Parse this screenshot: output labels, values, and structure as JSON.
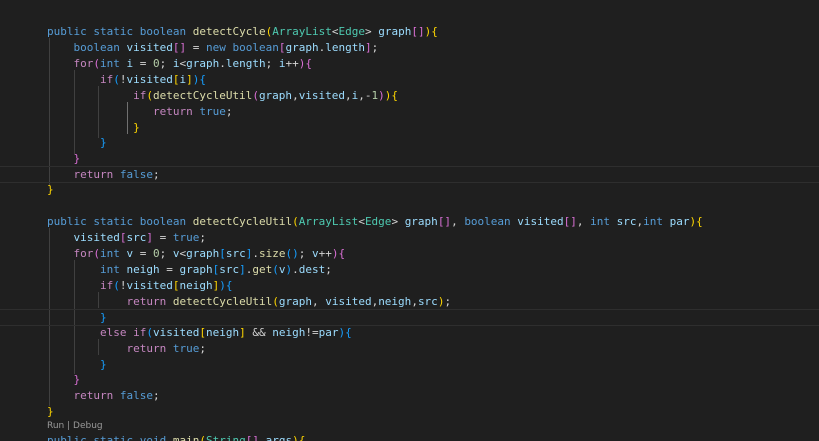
{
  "editor": {
    "language": "java",
    "theme_background": "#1f1f1f",
    "codelens": {
      "run": "Run",
      "separator": " | ",
      "debug": "Debug"
    },
    "lines": [
      [
        [
          "kw",
          "public"
        ],
        [
          "op",
          " "
        ],
        [
          "kw",
          "static"
        ],
        [
          "op",
          " "
        ],
        [
          "kw",
          "boolean"
        ],
        [
          "op",
          " "
        ],
        [
          "fn",
          "detectCycle"
        ],
        [
          "b1",
          "("
        ],
        [
          "ty",
          "ArrayList"
        ],
        [
          "op",
          "<"
        ],
        [
          "ty",
          "Edge"
        ],
        [
          "op",
          "> "
        ],
        [
          "var",
          "graph"
        ],
        [
          "b2",
          "[]"
        ],
        [
          "b1",
          ")"
        ],
        [
          "b1",
          "{"
        ]
      ],
      [
        [
          "op",
          "    "
        ],
        [
          "kw",
          "boolean"
        ],
        [
          "op",
          " "
        ],
        [
          "var",
          "visited"
        ],
        [
          "b2",
          "[]"
        ],
        [
          "op",
          " = "
        ],
        [
          "kw",
          "new"
        ],
        [
          "op",
          " "
        ],
        [
          "kw",
          "boolean"
        ],
        [
          "b2",
          "["
        ],
        [
          "var",
          "graph"
        ],
        [
          "op",
          "."
        ],
        [
          "var",
          "length"
        ],
        [
          "b2",
          "]"
        ],
        [
          "op",
          ";"
        ]
      ],
      [
        [
          "op",
          "    "
        ],
        [
          "ctl",
          "for"
        ],
        [
          "b2",
          "("
        ],
        [
          "kw",
          "int"
        ],
        [
          "op",
          " "
        ],
        [
          "var",
          "i"
        ],
        [
          "op",
          " = "
        ],
        [
          "num",
          "0"
        ],
        [
          "op",
          "; "
        ],
        [
          "var",
          "i"
        ],
        [
          "op",
          "<"
        ],
        [
          "var",
          "graph"
        ],
        [
          "op",
          "."
        ],
        [
          "var",
          "length"
        ],
        [
          "op",
          "; "
        ],
        [
          "var",
          "i"
        ],
        [
          "op",
          "++"
        ],
        [
          "b2",
          ")"
        ],
        [
          "b2",
          "{"
        ]
      ],
      [
        [
          "op",
          "        "
        ],
        [
          "ctl",
          "if"
        ],
        [
          "b3",
          "("
        ],
        [
          "op",
          "!"
        ],
        [
          "var",
          "visited"
        ],
        [
          "b1",
          "["
        ],
        [
          "var",
          "i"
        ],
        [
          "b1",
          "]"
        ],
        [
          "b3",
          ")"
        ],
        [
          "b3",
          "{"
        ]
      ],
      [
        [
          "op",
          "             "
        ],
        [
          "ctl",
          "if"
        ],
        [
          "b1",
          "("
        ],
        [
          "fn",
          "detectCycleUtil"
        ],
        [
          "b2",
          "("
        ],
        [
          "var",
          "graph"
        ],
        [
          "op",
          ","
        ],
        [
          "var",
          "visited"
        ],
        [
          "op",
          ","
        ],
        [
          "var",
          "i"
        ],
        [
          "op",
          ","
        ],
        [
          "op",
          "-"
        ],
        [
          "num",
          "1"
        ],
        [
          "b2",
          ")"
        ],
        [
          "b1",
          ")"
        ],
        [
          "b1",
          "{"
        ]
      ],
      [
        [
          "op",
          "                "
        ],
        [
          "ctl",
          "return"
        ],
        [
          "op",
          " "
        ],
        [
          "kw",
          "true"
        ],
        [
          "op",
          ";"
        ]
      ],
      [
        [
          "op",
          "             "
        ],
        [
          "b1",
          "}"
        ]
      ],
      [
        [
          "op",
          "        "
        ],
        [
          "b3",
          "}"
        ]
      ],
      [
        [
          "op",
          "    "
        ],
        [
          "b2",
          "}"
        ]
      ],
      [
        [
          "op",
          "    "
        ],
        [
          "ctl",
          "return"
        ],
        [
          "op",
          " "
        ],
        [
          "kw",
          "false"
        ],
        [
          "op",
          ";"
        ]
      ],
      [
        [
          "b1",
          "}"
        ]
      ],
      [],
      [
        [
          "kw",
          "public"
        ],
        [
          "op",
          " "
        ],
        [
          "kw",
          "static"
        ],
        [
          "op",
          " "
        ],
        [
          "kw",
          "boolean"
        ],
        [
          "op",
          " "
        ],
        [
          "fn",
          "detectCycleUtil"
        ],
        [
          "b1",
          "("
        ],
        [
          "ty",
          "ArrayList"
        ],
        [
          "op",
          "<"
        ],
        [
          "ty",
          "Edge"
        ],
        [
          "op",
          "> "
        ],
        [
          "var",
          "graph"
        ],
        [
          "b2",
          "[]"
        ],
        [
          "op",
          ", "
        ],
        [
          "kw",
          "boolean"
        ],
        [
          "op",
          " "
        ],
        [
          "var",
          "visited"
        ],
        [
          "b2",
          "[]"
        ],
        [
          "op",
          ", "
        ],
        [
          "kw",
          "int"
        ],
        [
          "op",
          " "
        ],
        [
          "var",
          "src"
        ],
        [
          "op",
          ","
        ],
        [
          "kw",
          "int"
        ],
        [
          "op",
          " "
        ],
        [
          "var",
          "par"
        ],
        [
          "b1",
          ")"
        ],
        [
          "b1",
          "{"
        ]
      ],
      [
        [
          "op",
          "    "
        ],
        [
          "var",
          "visited"
        ],
        [
          "b2",
          "["
        ],
        [
          "var",
          "src"
        ],
        [
          "b2",
          "]"
        ],
        [
          "op",
          " = "
        ],
        [
          "kw",
          "true"
        ],
        [
          "op",
          ";"
        ]
      ],
      [
        [
          "op",
          "    "
        ],
        [
          "ctl",
          "for"
        ],
        [
          "b2",
          "("
        ],
        [
          "kw",
          "int"
        ],
        [
          "op",
          " "
        ],
        [
          "var",
          "v"
        ],
        [
          "op",
          " = "
        ],
        [
          "num",
          "0"
        ],
        [
          "op",
          "; "
        ],
        [
          "var",
          "v"
        ],
        [
          "op",
          "<"
        ],
        [
          "var",
          "graph"
        ],
        [
          "b3",
          "["
        ],
        [
          "var",
          "src"
        ],
        [
          "b3",
          "]"
        ],
        [
          "op",
          "."
        ],
        [
          "fn",
          "size"
        ],
        [
          "b3",
          "()"
        ],
        [
          "op",
          "; "
        ],
        [
          "var",
          "v"
        ],
        [
          "op",
          "++"
        ],
        [
          "b2",
          ")"
        ],
        [
          "b2",
          "{"
        ]
      ],
      [
        [
          "op",
          "        "
        ],
        [
          "kw",
          "int"
        ],
        [
          "op",
          " "
        ],
        [
          "var",
          "neigh"
        ],
        [
          "op",
          " = "
        ],
        [
          "var",
          "graph"
        ],
        [
          "b3",
          "["
        ],
        [
          "var",
          "src"
        ],
        [
          "b3",
          "]"
        ],
        [
          "op",
          "."
        ],
        [
          "fn",
          "get"
        ],
        [
          "b3",
          "("
        ],
        [
          "var",
          "v"
        ],
        [
          "b3",
          ")"
        ],
        [
          "op",
          "."
        ],
        [
          "var",
          "dest"
        ],
        [
          "op",
          ";"
        ]
      ],
      [
        [
          "op",
          "        "
        ],
        [
          "ctl",
          "if"
        ],
        [
          "b3",
          "("
        ],
        [
          "op",
          "!"
        ],
        [
          "var",
          "visited"
        ],
        [
          "b1",
          "["
        ],
        [
          "var",
          "neigh"
        ],
        [
          "b1",
          "]"
        ],
        [
          "b3",
          ")"
        ],
        [
          "b3",
          "{"
        ]
      ],
      [
        [
          "op",
          "            "
        ],
        [
          "ctl",
          "return"
        ],
        [
          "op",
          " "
        ],
        [
          "fn",
          "detectCycleUtil"
        ],
        [
          "b1",
          "("
        ],
        [
          "var",
          "graph"
        ],
        [
          "op",
          ", "
        ],
        [
          "var",
          "visited"
        ],
        [
          "op",
          ","
        ],
        [
          "var",
          "neigh"
        ],
        [
          "op",
          ","
        ],
        [
          "var",
          "src"
        ],
        [
          "b1",
          ")"
        ],
        [
          "op",
          ";"
        ]
      ],
      [
        [
          "op",
          "        "
        ],
        [
          "b3",
          "}"
        ]
      ],
      [
        [
          "op",
          "        "
        ],
        [
          "ctl",
          "else"
        ],
        [
          "op",
          " "
        ],
        [
          "ctl",
          "if"
        ],
        [
          "b3",
          "("
        ],
        [
          "var",
          "visited"
        ],
        [
          "b1",
          "["
        ],
        [
          "var",
          "neigh"
        ],
        [
          "b1",
          "]"
        ],
        [
          "op",
          " && "
        ],
        [
          "var",
          "neigh"
        ],
        [
          "op",
          "!="
        ],
        [
          "var",
          "par"
        ],
        [
          "b3",
          ")"
        ],
        [
          "b3",
          "{"
        ]
      ],
      [
        [
          "op",
          "            "
        ],
        [
          "ctl",
          "return"
        ],
        [
          "op",
          " "
        ],
        [
          "kw",
          "true"
        ],
        [
          "op",
          ";"
        ]
      ],
      [
        [
          "op",
          "        "
        ],
        [
          "b3",
          "}"
        ]
      ],
      [
        [
          "op",
          "    "
        ],
        [
          "b2",
          "}"
        ]
      ],
      [
        [
          "op",
          "    "
        ],
        [
          "ctl",
          "return"
        ],
        [
          "op",
          " "
        ],
        [
          "kw",
          "false"
        ],
        [
          "op",
          ";"
        ]
      ],
      [
        [
          "b1",
          "}"
        ]
      ],
      [
        [
          "kw",
          "public"
        ],
        [
          "op",
          " "
        ],
        [
          "kw",
          "static"
        ],
        [
          "op",
          " "
        ],
        [
          "kw",
          "void"
        ],
        [
          "op",
          " "
        ],
        [
          "fn",
          "main"
        ],
        [
          "b1",
          "("
        ],
        [
          "ty",
          "String"
        ],
        [
          "b2",
          "[]"
        ],
        [
          "op",
          " "
        ],
        [
          "var",
          "args"
        ],
        [
          "b1",
          ")"
        ],
        [
          "b1",
          "{"
        ]
      ]
    ]
  }
}
